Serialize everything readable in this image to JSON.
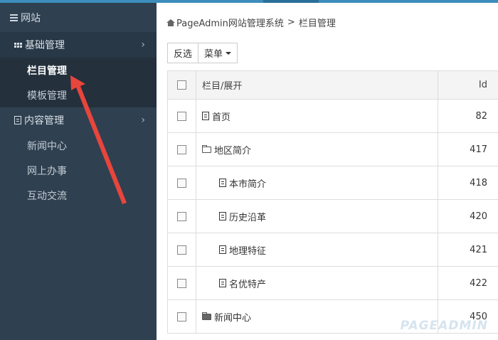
{
  "sidebar": {
    "header": "网站",
    "groups": [
      {
        "label": "基础管理",
        "items": [
          "栏目管理",
          "模板管理"
        ]
      },
      {
        "label": "内容管理",
        "items": [
          "新闻中心",
          "网上办事",
          "互动交流"
        ]
      }
    ]
  },
  "breadcrumb": {
    "root": "PageAdmin网站管理系统",
    "sep": ">",
    "current": "栏目管理"
  },
  "toolbar": {
    "invert_label": "反选",
    "menu_label": "菜单"
  },
  "table": {
    "headers": {
      "name": "栏目/展开",
      "id": "Id"
    },
    "rows": [
      {
        "name": "首页",
        "id": "82"
      },
      {
        "name": "地区简介",
        "id": "417"
      },
      {
        "name": "本市简介",
        "id": "418"
      },
      {
        "name": "历史沿革",
        "id": "420"
      },
      {
        "name": "地理特征",
        "id": "421"
      },
      {
        "name": "名优特产",
        "id": "422"
      },
      {
        "name": "新闻中心",
        "id": "450"
      }
    ]
  },
  "watermark": "PAGEADMIN",
  "colors": {
    "sidebar_bg": "#2f4050",
    "accent": "#3c8dbc",
    "arrow": "#e8453c"
  }
}
